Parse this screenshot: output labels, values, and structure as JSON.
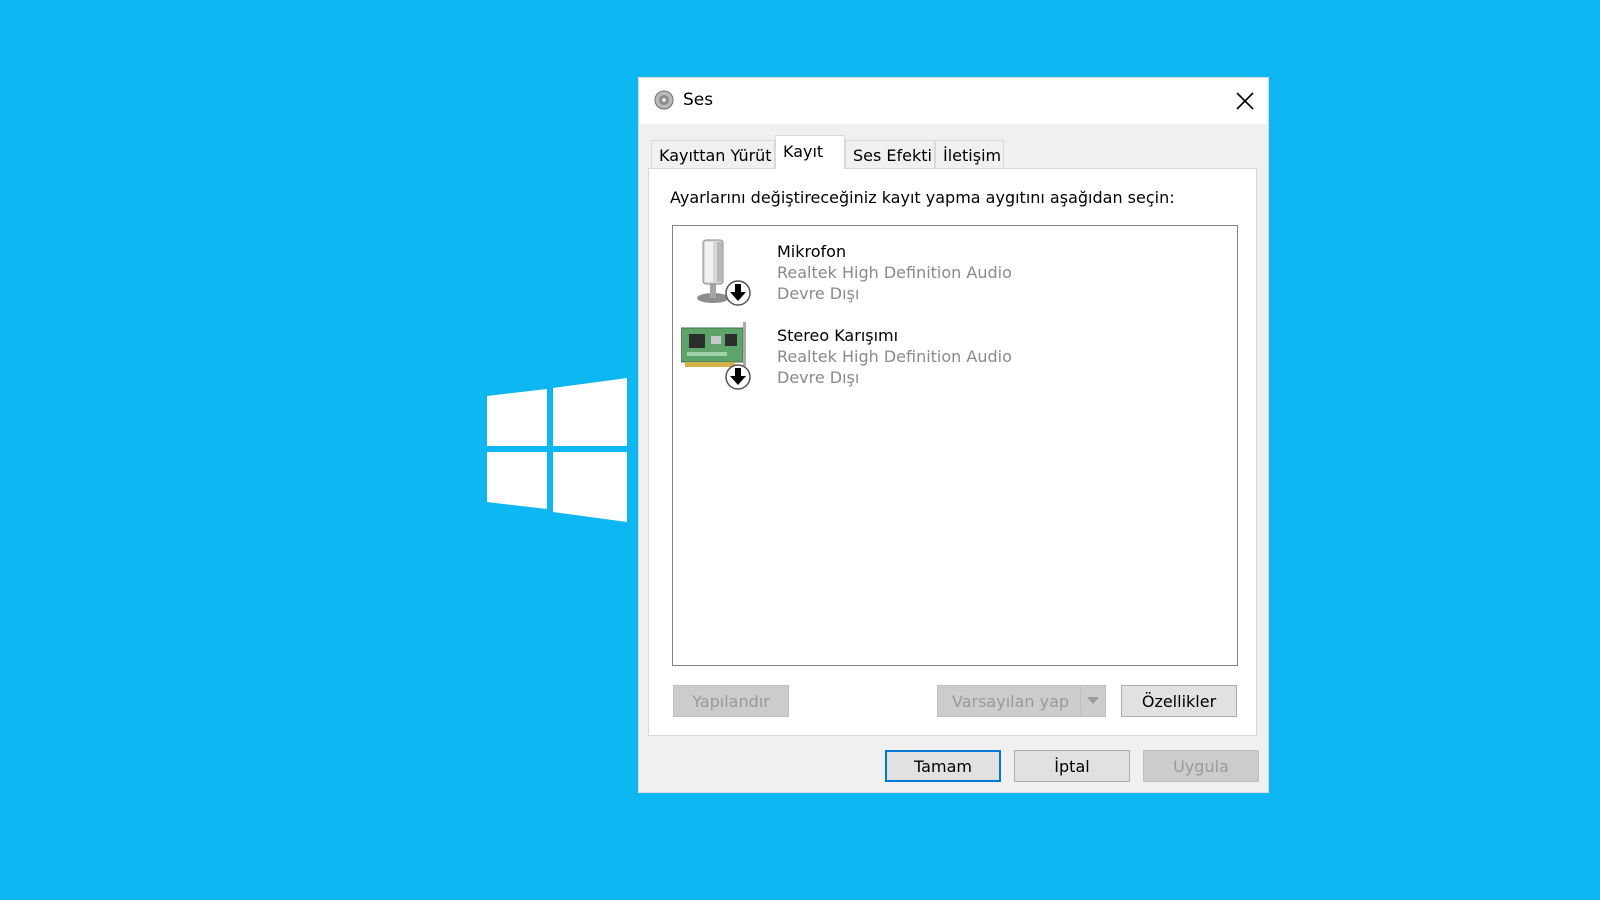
{
  "dialog": {
    "title": "Ses",
    "tabs": [
      "Kayıttan Yürüt",
      "Kayıt",
      "Ses Efekti",
      "İletişim"
    ],
    "active_tab": "Kayıt",
    "instruction": "Ayarlarını değiştireceğiniz kayıt yapma aygıtını aşağıdan seçin:",
    "devices": [
      {
        "name": "Mikrofon",
        "driver": "Realtek High Definition Audio",
        "status": "Devre Dışı",
        "icon": "microphone-icon"
      },
      {
        "name": "Stereo Karışımı",
        "driver": "Realtek High Definition Audio",
        "status": "Devre Dışı",
        "icon": "sound-card-icon"
      }
    ],
    "buttons": {
      "configure": "Yapılandır",
      "set_default": "Varsayılan yap",
      "properties": "Özellikler",
      "ok": "Tamam",
      "cancel": "İptal",
      "apply": "Uygula"
    }
  },
  "colors": {
    "desktop": "#0db7f2",
    "accent": "#0078d7",
    "disabled_text": "#8a8a8a"
  }
}
